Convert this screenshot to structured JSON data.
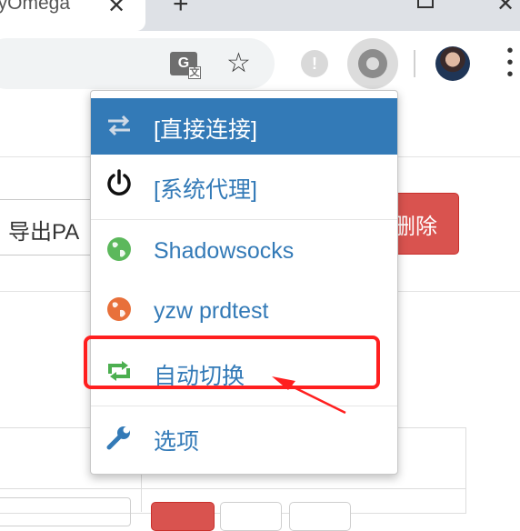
{
  "tab": {
    "title": "nyOmega",
    "close_glyph": "✕"
  },
  "newtab_glyph": "+",
  "window": {
    "close_glyph": "✕"
  },
  "toolbar": {
    "translate_glyph": "G",
    "translate_sub": "文"
  },
  "page": {
    "export_button": "导出PA",
    "delete_button": "删除"
  },
  "popup": {
    "items": [
      {
        "label": "[直接连接]",
        "icon": "swap-arrows-icon",
        "active": true
      },
      {
        "label": "[系统代理]",
        "icon": "power-icon",
        "active": false
      },
      {
        "label": "Shadowsocks",
        "icon": "globe-green-icon",
        "active": false
      },
      {
        "label": "yzw prdtest",
        "icon": "globe-orange-icon",
        "active": false
      },
      {
        "label": "自动切换",
        "icon": "auto-switch-icon",
        "active": false
      },
      {
        "label": "选项",
        "icon": "wrench-icon",
        "active": false
      }
    ]
  },
  "colors": {
    "accent": "#337ab7",
    "active_bg": "#337ab7",
    "highlight": "#ff1f1f",
    "danger": "#d9534f",
    "globe_green": "#5cb85c",
    "globe_orange": "#e8703a",
    "auto_switch_green": "#4caf50"
  }
}
